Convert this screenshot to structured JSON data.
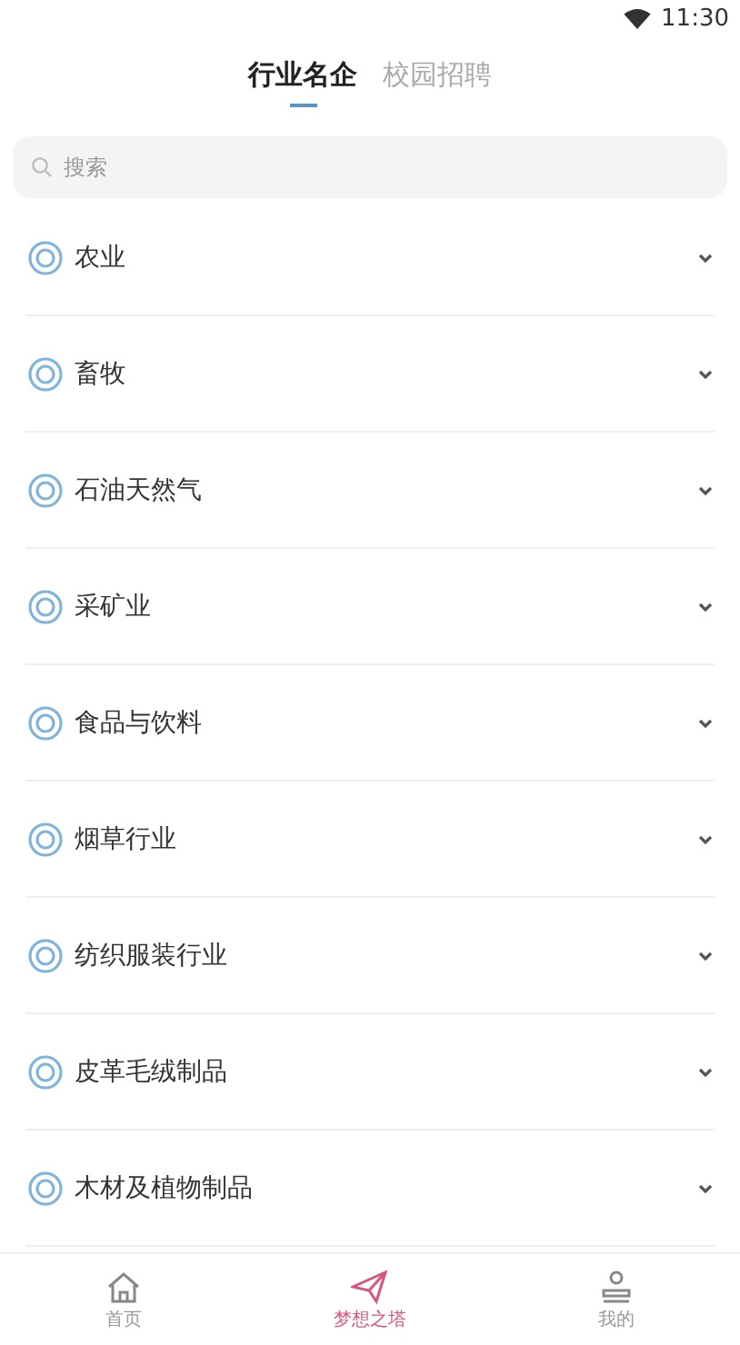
{
  "status_bar": {
    "time": "11:30"
  },
  "tabs": [
    {
      "label": "行业名企",
      "selected": true
    },
    {
      "label": "校园招聘",
      "selected": false
    }
  ],
  "search": {
    "placeholder": "搜索"
  },
  "industries": [
    {
      "label": "农业",
      "expanded": false
    },
    {
      "label": "畜牧",
      "expanded": false
    },
    {
      "label": "石油天然气",
      "expanded": false
    },
    {
      "label": "采矿业",
      "expanded": false
    },
    {
      "label": "食品与饮料",
      "expanded": false
    },
    {
      "label": "烟草行业",
      "expanded": false
    },
    {
      "label": "纺织服装行业",
      "expanded": false
    },
    {
      "label": "皮革毛绒制品",
      "expanded": false
    },
    {
      "label": "木材及植物制品",
      "expanded": false
    }
  ],
  "bottom_nav": [
    {
      "label": "首页",
      "kind": "home",
      "selected": false
    },
    {
      "label": "梦想之塔",
      "kind": "plane",
      "selected": true
    },
    {
      "label": "我的",
      "kind": "person",
      "selected": false
    }
  ]
}
